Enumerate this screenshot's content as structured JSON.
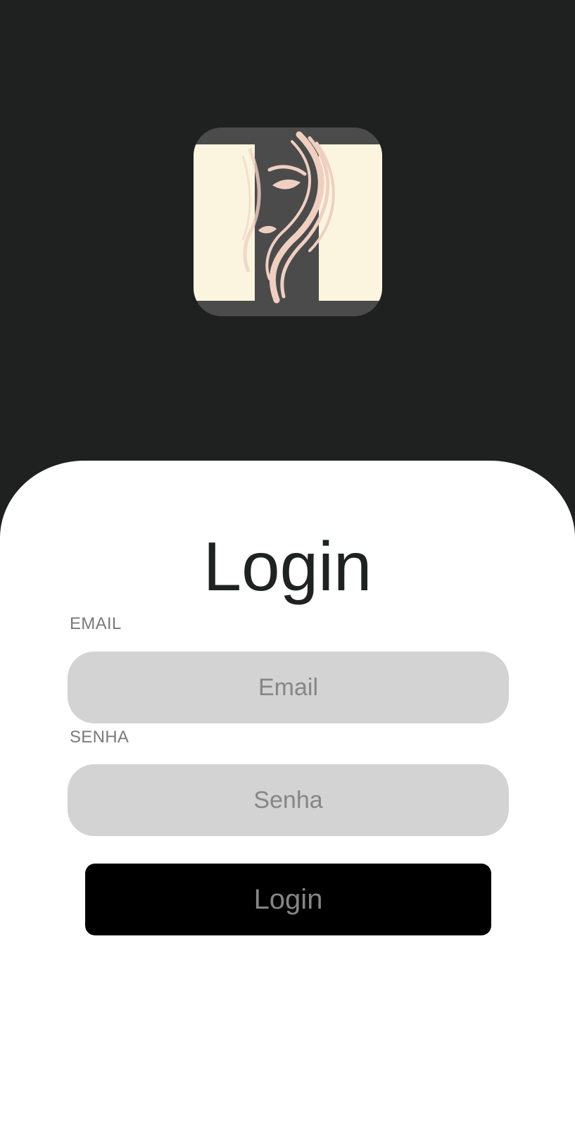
{
  "colors": {
    "header_background": "#1f2120",
    "card_background": "#ffffff",
    "input_background": "#d3d3d3",
    "button_background": "#000000",
    "logo_cream": "#fbf5df",
    "logo_dark": "#4b4b4b",
    "logo_accent": "#f0cfc1"
  },
  "header": {
    "logo_icon": "woman-face-hair-logo-icon"
  },
  "login": {
    "title": "Login",
    "email_label": "EMAIL",
    "email_placeholder": "Email",
    "email_value": "",
    "password_label": "SENHA",
    "password_placeholder": "Senha",
    "password_value": "",
    "submit_label": "Login"
  }
}
